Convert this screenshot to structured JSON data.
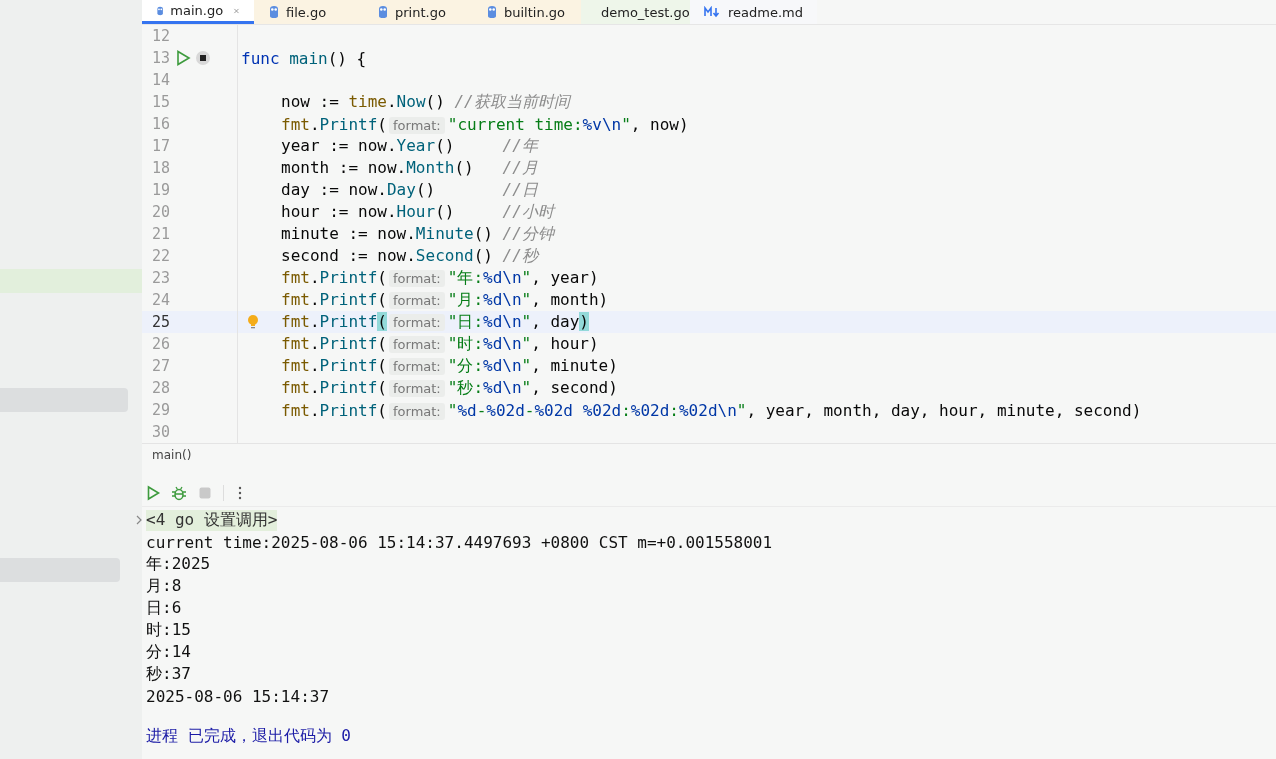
{
  "tabs": [
    {
      "label": "main.go",
      "selected": true,
      "kind": "gopher",
      "color": "#ffffff"
    },
    {
      "label": "file.go",
      "selected": false,
      "kind": "gopher",
      "color": "#fbf3e2"
    },
    {
      "label": "print.go",
      "selected": false,
      "kind": "gopher",
      "color": "#fbf3e2"
    },
    {
      "label": "builtin.go",
      "selected": false,
      "kind": "gopher",
      "color": "#fbf3e2"
    },
    {
      "label": "demo_test.go",
      "selected": false,
      "kind": "test",
      "color": "#eef6ea"
    },
    {
      "label": "readme.md",
      "selected": false,
      "kind": "markdown",
      "color": "#f7f8fa"
    }
  ],
  "editor": {
    "lines": [
      {
        "n": "12",
        "current": false
      },
      {
        "n": "13",
        "current": false,
        "kind": "run",
        "tokens": [
          {
            "kind": "kw",
            "t": "func "
          },
          {
            "kind": "decl",
            "t": "main"
          },
          {
            "kind": "plain",
            "t": "() {"
          }
        ],
        "children": [
          {
            "n": "14",
            "current": false
          },
          {
            "n": "15",
            "current": false,
            "tokens": [
              {
                "kind": "plain",
                "t": "now := "
              },
              {
                "kind": "pkg",
                "t": "time"
              },
              {
                "kind": "plain",
                "t": "."
              },
              {
                "kind": "call",
                "t": "Now"
              },
              {
                "kind": "plain",
                "t": "() "
              },
              {
                "kind": "cmt",
                "t": "//获取当前时间"
              }
            ]
          },
          {
            "n": "16",
            "current": false,
            "tokens": [
              {
                "kind": "pkg",
                "t": "fmt"
              },
              {
                "kind": "plain",
                "t": "."
              },
              {
                "kind": "call",
                "t": "Printf"
              },
              {
                "kind": "plain",
                "t": "("
              },
              {
                "kind": "hint",
                "t": "format:"
              },
              {
                "kind": "str",
                "t": "\"current time:"
              },
              {
                "kind": "esc",
                "t": "%v\\n"
              },
              {
                "kind": "str",
                "t": "\""
              },
              {
                "kind": "plain",
                "t": ", now)"
              }
            ]
          },
          {
            "n": "17",
            "current": false,
            "tokens": [
              {
                "kind": "plain",
                "t": "year := now."
              },
              {
                "kind": "call",
                "t": "Year"
              },
              {
                "kind": "plain",
                "t": "()     "
              },
              {
                "kind": "cmt",
                "t": "//年"
              }
            ]
          },
          {
            "n": "18",
            "current": false,
            "tokens": [
              {
                "kind": "plain",
                "t": "month := now."
              },
              {
                "kind": "call",
                "t": "Month"
              },
              {
                "kind": "plain",
                "t": "()   "
              },
              {
                "kind": "cmt",
                "t": "//月"
              }
            ]
          },
          {
            "n": "19",
            "current": false,
            "tokens": [
              {
                "kind": "plain",
                "t": "day := now."
              },
              {
                "kind": "call",
                "t": "Day"
              },
              {
                "kind": "plain",
                "t": "()       "
              },
              {
                "kind": "cmt",
                "t": "//日"
              }
            ]
          },
          {
            "n": "20",
            "current": false,
            "tokens": [
              {
                "kind": "plain",
                "t": "hour := now."
              },
              {
                "kind": "call",
                "t": "Hour"
              },
              {
                "kind": "plain",
                "t": "()     "
              },
              {
                "kind": "cmt",
                "t": "//小时"
              }
            ]
          },
          {
            "n": "21",
            "current": false,
            "tokens": [
              {
                "kind": "plain",
                "t": "minute := now."
              },
              {
                "kind": "call",
                "t": "Minute"
              },
              {
                "kind": "plain",
                "t": "() "
              },
              {
                "kind": "cmt",
                "t": "//分钟"
              }
            ]
          },
          {
            "n": "22",
            "current": false,
            "tokens": [
              {
                "kind": "plain",
                "t": "second := now."
              },
              {
                "kind": "call",
                "t": "Second"
              },
              {
                "kind": "plain",
                "t": "() "
              },
              {
                "kind": "cmt",
                "t": "//秒"
              }
            ]
          },
          {
            "n": "23",
            "current": false,
            "tokens": [
              {
                "kind": "pkg",
                "t": "fmt"
              },
              {
                "kind": "plain",
                "t": "."
              },
              {
                "kind": "call",
                "t": "Printf"
              },
              {
                "kind": "plain",
                "t": "("
              },
              {
                "kind": "hint",
                "t": "format:"
              },
              {
                "kind": "str",
                "t": "\"年:"
              },
              {
                "kind": "esc",
                "t": "%d\\n"
              },
              {
                "kind": "str",
                "t": "\""
              },
              {
                "kind": "plain",
                "t": ", year)"
              }
            ]
          },
          {
            "n": "24",
            "current": false,
            "tokens": [
              {
                "kind": "pkg",
                "t": "fmt"
              },
              {
                "kind": "plain",
                "t": "."
              },
              {
                "kind": "call",
                "t": "Printf"
              },
              {
                "kind": "plain",
                "t": "("
              },
              {
                "kind": "hint",
                "t": "format:"
              },
              {
                "kind": "str",
                "t": "\"月:"
              },
              {
                "kind": "esc",
                "t": "%d\\n"
              },
              {
                "kind": "str",
                "t": "\""
              },
              {
                "kind": "plain",
                "t": ", month)"
              }
            ]
          },
          {
            "n": "25",
            "current": true,
            "kind": "bulb",
            "tokens": [
              {
                "kind": "pkg",
                "t": "fmt"
              },
              {
                "kind": "plain",
                "t": "."
              },
              {
                "kind": "call",
                "t": "Printf"
              },
              {
                "kind": "match",
                "t": "("
              },
              {
                "kind": "hint",
                "t": "format:"
              },
              {
                "kind": "str",
                "t": "\"日:"
              },
              {
                "kind": "esc",
                "t": "%d\\n"
              },
              {
                "kind": "str",
                "t": "\""
              },
              {
                "kind": "plain",
                "t": ", day"
              },
              {
                "kind": "match",
                "t": ")"
              }
            ]
          },
          {
            "n": "26",
            "current": false,
            "tokens": [
              {
                "kind": "pkg",
                "t": "fmt"
              },
              {
                "kind": "plain",
                "t": "."
              },
              {
                "kind": "call",
                "t": "Printf"
              },
              {
                "kind": "plain",
                "t": "("
              },
              {
                "kind": "hint",
                "t": "format:"
              },
              {
                "kind": "str",
                "t": "\"时:"
              },
              {
                "kind": "esc",
                "t": "%d\\n"
              },
              {
                "kind": "str",
                "t": "\""
              },
              {
                "kind": "plain",
                "t": ", hour)"
              }
            ]
          },
          {
            "n": "27",
            "current": false,
            "tokens": [
              {
                "kind": "pkg",
                "t": "fmt"
              },
              {
                "kind": "plain",
                "t": "."
              },
              {
                "kind": "call",
                "t": "Printf"
              },
              {
                "kind": "plain",
                "t": "("
              },
              {
                "kind": "hint",
                "t": "format:"
              },
              {
                "kind": "str",
                "t": "\"分:"
              },
              {
                "kind": "esc",
                "t": "%d\\n"
              },
              {
                "kind": "str",
                "t": "\""
              },
              {
                "kind": "plain",
                "t": ", minute)"
              }
            ]
          },
          {
            "n": "28",
            "current": false,
            "tokens": [
              {
                "kind": "pkg",
                "t": "fmt"
              },
              {
                "kind": "plain",
                "t": "."
              },
              {
                "kind": "call",
                "t": "Printf"
              },
              {
                "kind": "plain",
                "t": "("
              },
              {
                "kind": "hint",
                "t": "format:"
              },
              {
                "kind": "str",
                "t": "\"秒:"
              },
              {
                "kind": "esc",
                "t": "%d\\n"
              },
              {
                "kind": "str",
                "t": "\""
              },
              {
                "kind": "plain",
                "t": ", second)"
              }
            ]
          },
          {
            "n": "29",
            "current": false,
            "tokens": [
              {
                "kind": "pkg",
                "t": "fmt"
              },
              {
                "kind": "plain",
                "t": "."
              },
              {
                "kind": "call",
                "t": "Printf"
              },
              {
                "kind": "plain",
                "t": "("
              },
              {
                "kind": "hint",
                "t": "format:"
              },
              {
                "kind": "str",
                "t": "\""
              },
              {
                "kind": "esc",
                "t": "%d"
              },
              {
                "kind": "str",
                "t": "-"
              },
              {
                "kind": "esc",
                "t": "%02d"
              },
              {
                "kind": "str",
                "t": "-"
              },
              {
                "kind": "esc",
                "t": "%02d %02d"
              },
              {
                "kind": "str",
                "t": ":"
              },
              {
                "kind": "esc",
                "t": "%02d"
              },
              {
                "kind": "str",
                "t": ":"
              },
              {
                "kind": "esc",
                "t": "%02d\\n"
              },
              {
                "kind": "str",
                "t": "\""
              },
              {
                "kind": "plain",
                "t": ", year, month, day, hour, minute, second)"
              }
            ]
          },
          {
            "n": "30",
            "current": false
          }
        ]
      }
    ],
    "breadcrumb": "main()"
  },
  "run_toolbar": [
    {
      "kind": "run"
    },
    {
      "kind": "debug"
    },
    {
      "kind": "stop"
    },
    {
      "kind": "more"
    }
  ],
  "console": [
    {
      "kind": "command",
      "text": "<4 go 设置调用>"
    },
    {
      "kind": "output",
      "text": "current time:2025-08-06 15:14:37.4497693 +0800 CST m=+0.001558001"
    },
    {
      "kind": "output",
      "text": "年:2025"
    },
    {
      "kind": "output",
      "text": "月:8"
    },
    {
      "kind": "output",
      "text": "日:6"
    },
    {
      "kind": "output",
      "text": "时:15"
    },
    {
      "kind": "output",
      "text": "分:14"
    },
    {
      "kind": "output",
      "text": "秒:37"
    },
    {
      "kind": "output",
      "text": "2025-08-06 15:14:37"
    },
    {
      "kind": "exit",
      "text": "进程 已完成，退出代码为 0"
    }
  ]
}
